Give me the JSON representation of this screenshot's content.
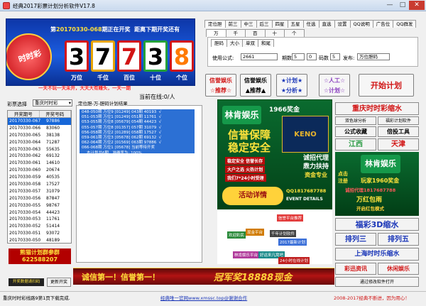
{
  "window": {
    "title": "经典2017彩票计划分析软件V17.8",
    "min": "—",
    "max": "□",
    "close": "✕"
  },
  "banner": {
    "issue_prefix": "第",
    "issue_num": "20170330-068",
    "issue_suffix": "期正在开奖",
    "countdown": "距离下期开奖还有",
    "balls": [
      "3",
      "7",
      "7",
      "3",
      "8"
    ],
    "positions": [
      "万位",
      "千位",
      "百位",
      "十位",
      "个位"
    ],
    "logo": "时时彩",
    "slogan": "一天不玩一天未开，大天大有赚头，一天一期"
  },
  "tabs1": [
    "定位胆",
    "前三",
    "中三",
    "后三",
    "四星",
    "五星",
    "任选",
    "直选",
    "设置",
    "QQ说明",
    "广告位",
    "QQ群发"
  ],
  "tabs2": [
    "万",
    "千",
    "百",
    "十",
    "个"
  ],
  "subtabs": [
    "胆码",
    "大小",
    "单双",
    "和尾"
  ],
  "cfg": {
    "formula_label": "使用公式:",
    "formula": "2661",
    "period_label": "期数",
    "period": "5",
    "periods2": "0",
    "send_label": "码数",
    "send2": "5",
    "send_label2": "发布:",
    "target": "万位胆码"
  },
  "actions": [
    {
      "line1": "信誉娱乐",
      "line2": "☆推荐☆",
      "color": "#d11616"
    },
    {
      "line1": "信誉娱乐",
      "line2": "▲推荐▲",
      "color": "#000000"
    },
    {
      "line1": "★计划★",
      "line2": "★分析★",
      "color": "#1a36b8"
    },
    {
      "line1": "☆人工☆",
      "line2": "☆计划☆",
      "color": "#8a3fbf"
    },
    {
      "line1": "开始计划",
      "line2": "",
      "color": "#d11616"
    }
  ],
  "online": "当前在线:0/人",
  "left": {
    "select_label": "彩票选择",
    "select_value": "重庆时时彩",
    "headers": [
      "开奖期号",
      "开奖号码"
    ],
    "rows": [
      [
        "20170330-067",
        "97886"
      ],
      [
        "20170330-066",
        "83060"
      ],
      [
        "20170330-065",
        "38138"
      ],
      [
        "20170330-064",
        "71287"
      ],
      [
        "20170330-063",
        "55635"
      ],
      [
        "20170330-062",
        "69132"
      ],
      [
        "20170330-061",
        "14610"
      ],
      [
        "20170330-060",
        "20674"
      ],
      [
        "20170330-059",
        "40535"
      ],
      [
        "20170330-058",
        "17527"
      ],
      [
        "20170330-057",
        "31079"
      ],
      [
        "20170330-056",
        "87847"
      ],
      [
        "20170330-055",
        "98767"
      ],
      [
        "20170330-054",
        "44423"
      ],
      [
        "20170330-053",
        "11761"
      ],
      [
        "20170330-052",
        "51414"
      ],
      [
        "20170330-051",
        "93072"
      ],
      [
        "20170330-050",
        "48189"
      ]
    ],
    "badge1": "熊猫计划群参群",
    "badge2": "622588207",
    "btn_open": "开奖数据请扫码",
    "btn_update": "更新开奖"
  },
  "center": {
    "caption": "定位胆-万-胆码计划结果",
    "lines": [
      "048-050期 万位9 [01249] 043期 40193  √",
      "051-053期 万位1 [01249] 051期 11761  √",
      "053-055期 万位8 [05679] 054期 44423  √",
      "055-057期 万位8 [01357] 057期 31079  √",
      "056-058期 万位2 [01289] 058期 17527  √",
      "059-061期 万位3 [05678] 062期 69132  √",
      "062-064期 万位2 [01569] 063期 97886  √",
      "066-068期 万位1 [05678] 当前等待开奖",
      "    本计划共6期，准确率为: 100%"
    ]
  },
  "ads": {
    "brand1": "林肯娱乐",
    "prize": "1966奖金",
    "t1": "信誉保障",
    "t2": "稳定安全",
    "casino": "KENO",
    "bar1": "稳定安全 信誉长存",
    "bar2": "大户之选 火热计划",
    "bar3": "资金专业",
    "bar4": "我们7*24小时受理",
    "bar5": "诚招代理",
    "bar6": "鼎力扶持",
    "event": "活动详情",
    "qq": "QQ1817687788",
    "ev2": "EVENT DETAILS",
    "chips": [
      "现金网",
      "钱金网"
    ],
    "mid": [
      "信誉平台推荐",
      "欢迎彩民",
      "现金平台",
      "千年计划软件",
      "2017最新计划",
      "林肯娱乐平台",
      "好运来凡窝吧",
      "24小时在线计划"
    ]
  },
  "right": {
    "b1": "重庆时时彩缩水",
    "b2": "双色球分析",
    "b3": "福彩计划软件",
    "b4": "公式收藏",
    "b5": "倍投工具",
    "b6": "江西",
    "b7": "天津",
    "ad": {
      "brand": "林肯娱乐",
      "p1": "点击",
      "p2": "注册",
      "pl": "玩家1960奖金",
      "qq": "诚招代理1817687788",
      "s1": "万红包雨",
      "s2": "开启红包模式"
    },
    "b8": "福彩3D缩水",
    "b9": "排列三",
    "b10": "排列五",
    "b11": "上海时时乐缩水",
    "b12": "彩迅资讯",
    "b13": "休闲娱乐",
    "b14": "通过修改软件打开"
  },
  "bottom_banner": {
    "l": "诚信第一！信誉第一！",
    "r": "冠军奖18888现金"
  },
  "status": {
    "left": "重庆时时彩线路9第1页下载完成.",
    "center": "经典唯一官网www.xmssc.top@谢谢合作",
    "right": "2008-2017经典不断进，因为用心！"
  }
}
